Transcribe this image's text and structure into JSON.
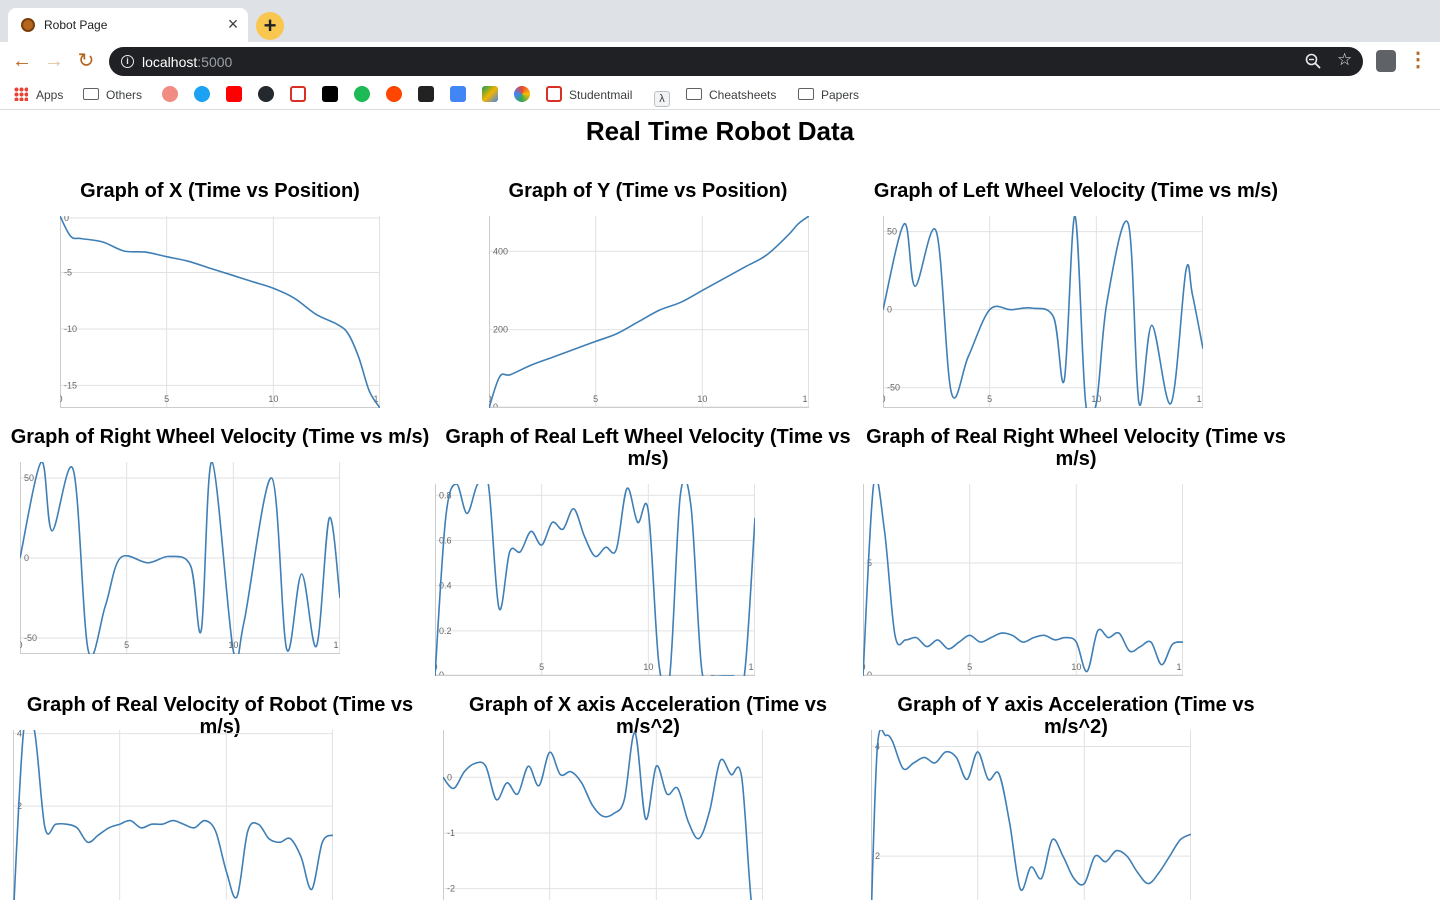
{
  "browser": {
    "tab_title": "Robot Page",
    "url_host": "localhost",
    "url_port": ":5000",
    "bookmarks": {
      "apps": "Apps",
      "others": "Others",
      "studentmail": "Studentmail",
      "cheatsheets": "Cheatsheets",
      "papers": "Papers"
    },
    "icons": [
      "favicon-icon",
      "close-icon",
      "plus-icon",
      "back-icon",
      "forward-icon",
      "reload-icon",
      "info-icon",
      "zoom-out-icon",
      "star-icon",
      "profile-icon",
      "menu-icon"
    ]
  },
  "page": {
    "title": "Real Time Robot Data"
  },
  "colors": {
    "line": "#3f7fb5",
    "grid": "#e2e2e2",
    "axis": "#cccccc"
  },
  "chart_data": [
    {
      "type": "line",
      "title": "Graph of X (Time vs Position)",
      "xticks": [
        "0",
        "5",
        "10",
        "1"
      ],
      "xlim": [
        0,
        15
      ],
      "yticks": [
        "0",
        "-5",
        "-10",
        "-15"
      ],
      "ytick_values": [
        0,
        -5,
        -10,
        -15
      ],
      "ylim": [
        -17,
        0
      ],
      "x": [
        0,
        0.5,
        1,
        2,
        3,
        4,
        5,
        6,
        7,
        8,
        9,
        10,
        11,
        12,
        13,
        13.5,
        14,
        14.5,
        15
      ],
      "y": [
        0,
        -1.8,
        -2,
        -2.3,
        -3.1,
        -3.2,
        -3.6,
        -4.0,
        -4.6,
        -5.2,
        -5.8,
        -6.4,
        -7.3,
        -8.7,
        -9.6,
        -10.4,
        -12.5,
        -15.5,
        -17
      ]
    },
    {
      "type": "line",
      "title": "Graph of Y (Time vs Position)",
      "xticks": [
        "0",
        "5",
        "10",
        "1"
      ],
      "xlim": [
        0,
        15
      ],
      "yticks": [
        "0",
        "200",
        "400"
      ],
      "ytick_values": [
        0,
        200,
        400
      ],
      "ylim": [
        0,
        490
      ],
      "x": [
        0,
        0.5,
        1,
        2,
        3,
        4,
        5,
        6,
        7,
        8,
        9,
        10,
        11,
        12,
        13,
        14,
        14.5,
        15
      ],
      "y": [
        0,
        80,
        85,
        110,
        130,
        150,
        170,
        190,
        220,
        250,
        270,
        300,
        330,
        360,
        390,
        440,
        470,
        490
      ]
    },
    {
      "type": "line",
      "title": "Graph of Left Wheel Velocity (Time vs m/s)",
      "xticks": [
        "0",
        "5",
        "10",
        "1"
      ],
      "xlim": [
        0,
        15
      ],
      "yticks": [
        "50",
        "0",
        "-50"
      ],
      "ytick_values": [
        50,
        0,
        -50
      ],
      "ylim": [
        -63,
        60
      ],
      "x": [
        0,
        1,
        1.5,
        2.5,
        3.2,
        4,
        5,
        6,
        7,
        8,
        8.5,
        9,
        9.5,
        10,
        10.5,
        11.5,
        12,
        12.6,
        13.5,
        14.2,
        14.5,
        15
      ],
      "y": [
        0,
        55,
        15,
        50,
        -53,
        -30,
        0,
        0,
        1,
        -5,
        -45,
        60,
        -60,
        -60,
        5,
        55,
        -60,
        -10,
        -60,
        25,
        10,
        -25
      ]
    },
    {
      "type": "line",
      "title": "Graph of Right Wheel Velocity (Time vs m/s)",
      "xticks": [
        "0",
        "5",
        "10",
        "1"
      ],
      "xlim": [
        0,
        15
      ],
      "yticks": [
        "50",
        "0",
        "-50"
      ],
      "ytick_values": [
        50,
        0,
        -50
      ],
      "ylim": [
        -60,
        60
      ],
      "x": [
        0,
        1,
        1.5,
        2.5,
        3.2,
        4,
        4.7,
        6,
        7,
        8,
        8.5,
        9,
        10,
        10.5,
        11.8,
        12.5,
        13.2,
        13.9,
        14.5,
        15
      ],
      "y": [
        0,
        60,
        17,
        55,
        -58,
        -30,
        0,
        -3,
        1,
        -5,
        -45,
        60,
        -58,
        -40,
        50,
        -57,
        -10,
        -55,
        25,
        -25
      ]
    },
    {
      "type": "line",
      "title": "Graph of Real Left Wheel Velocity (Time vs m/s)",
      "xticks": [
        "0",
        "5",
        "10",
        "1"
      ],
      "xlim": [
        0,
        15
      ],
      "yticks": [
        "0",
        "0.2",
        "0.4",
        "0.6",
        "0.8"
      ],
      "ytick_values": [
        0,
        0.2,
        0.4,
        0.6,
        0.8
      ],
      "ylim": [
        0,
        0.85
      ],
      "x": [
        0,
        0.5,
        1,
        1.5,
        2,
        2.5,
        3,
        3.5,
        4,
        4.5,
        5,
        5.5,
        6,
        6.5,
        7,
        7.5,
        8,
        8.5,
        9,
        9.5,
        10,
        10.5,
        11,
        11.5,
        12,
        12.5,
        13,
        13.5,
        14,
        14.5,
        15
      ],
      "y": [
        0,
        0.7,
        0.85,
        0.72,
        0.85,
        0.85,
        0.3,
        0.55,
        0.55,
        0.64,
        0.58,
        0.68,
        0.65,
        0.74,
        0.62,
        0.53,
        0.57,
        0.56,
        0.83,
        0.68,
        0.73,
        0.05,
        0,
        0.8,
        0.75,
        0.03,
        0,
        0,
        0,
        0,
        0.7
      ]
    },
    {
      "type": "line",
      "title": "Graph of Real Right Wheel Velocity (Time vs m/s)",
      "xticks": [
        "0",
        "5",
        "10",
        "1"
      ],
      "xlim": [
        0,
        15
      ],
      "yticks": [
        "5",
        "0"
      ],
      "ytick_values": [
        5,
        0
      ],
      "ylim": [
        0,
        8.5
      ],
      "x": [
        0,
        0.5,
        1,
        1.5,
        2,
        2.5,
        3,
        3.5,
        4,
        4.5,
        5,
        5.5,
        6,
        6.5,
        7,
        7.5,
        8,
        8.5,
        9,
        9.5,
        10,
        10.5,
        11,
        11.5,
        12,
        12.5,
        13,
        13.5,
        14,
        14.5,
        15
      ],
      "y": [
        0,
        8.5,
        6.5,
        1.8,
        1.6,
        1.7,
        1.3,
        1.6,
        1.2,
        1.5,
        1.8,
        1.5,
        1.7,
        1.9,
        1.8,
        1.5,
        1.7,
        1.8,
        1.6,
        1.7,
        1.5,
        0.2,
        2.0,
        1.7,
        1.9,
        1.1,
        1.3,
        1.5,
        0.5,
        1.4,
        1.5
      ]
    },
    {
      "type": "line",
      "title": "Graph of Real Velocity of Robot (Time vs m/s)",
      "xticks": [],
      "xlim": [
        0,
        15
      ],
      "yticks": [
        "4",
        "2"
      ],
      "ytick_values": [
        4,
        2
      ],
      "ylim": [
        -1.2,
        4.1
      ],
      "x": [
        0,
        0.5,
        1,
        1.5,
        2,
        2.5,
        3,
        3.5,
        4,
        4.5,
        5,
        5.5,
        6,
        6.5,
        7,
        7.5,
        8,
        8.5,
        9,
        9.5,
        10,
        10.5,
        11,
        11.5,
        12,
        12.5,
        13,
        13.5,
        14,
        14.5,
        15
      ],
      "y": [
        -1.2,
        4.1,
        4.1,
        1.4,
        1.5,
        1.5,
        1.4,
        1.0,
        1.2,
        1.4,
        1.5,
        1.6,
        1.4,
        1.5,
        1.5,
        1.6,
        1.5,
        1.4,
        1.6,
        1.3,
        0.2,
        -0.5,
        1.3,
        1.5,
        1.1,
        1.0,
        1.1,
        0.6,
        -0.3,
        1.0,
        1.2
      ]
    },
    {
      "type": "line",
      "title": "Graph of X axis Acceleration (Time vs m/s^2)",
      "xticks": [],
      "xlim": [
        0,
        15
      ],
      "yticks": [
        "0",
        "-1",
        "-2"
      ],
      "ytick_values": [
        0,
        -1,
        -2
      ],
      "ylim": [
        -2.6,
        0.85
      ],
      "x": [
        0,
        0.5,
        1,
        1.5,
        2,
        2.5,
        3,
        3.5,
        4,
        4.5,
        5,
        5.5,
        6,
        6.5,
        7,
        7.5,
        8,
        8.5,
        9,
        9.5,
        10,
        10.5,
        11,
        11.5,
        12,
        12.5,
        13,
        13.5,
        14,
        14.5,
        15
      ],
      "y": [
        0,
        -0.2,
        0.1,
        0.25,
        0.2,
        -0.4,
        -0.1,
        -0.3,
        0.2,
        -0.15,
        0.45,
        0.05,
        0.1,
        -0.1,
        -0.5,
        -0.7,
        -0.65,
        -0.4,
        0.8,
        -0.75,
        0.2,
        -0.3,
        -0.2,
        -0.8,
        -1.1,
        -0.6,
        0.3,
        0.05,
        0,
        -2.4,
        -2.6
      ]
    },
    {
      "type": "line",
      "title": "Graph of Y axis Acceleration (Time vs m/s^2)",
      "xticks": [],
      "xlim": [
        0,
        15
      ],
      "yticks": [
        "4",
        "2"
      ],
      "ytick_values": [
        4,
        2
      ],
      "ylim": [
        0.8,
        4.3
      ],
      "x": [
        0,
        0.3,
        0.7,
        1,
        1.5,
        2,
        2.5,
        3,
        3.5,
        4,
        4.5,
        5,
        5.5,
        6,
        6.5,
        7,
        7.5,
        8,
        8.5,
        9,
        9.5,
        10,
        10.5,
        11,
        11.5,
        12,
        12.5,
        13,
        13.5,
        14,
        14.5,
        15
      ],
      "y": [
        0.8,
        4.0,
        4.2,
        4.1,
        3.6,
        3.7,
        3.8,
        3.7,
        3.9,
        3.8,
        3.4,
        3.9,
        3.4,
        3.5,
        2.6,
        1.4,
        1.8,
        1.6,
        2.3,
        2.0,
        1.6,
        1.5,
        2.0,
        1.9,
        2.1,
        2.0,
        1.7,
        1.5,
        1.7,
        2.0,
        2.3,
        2.4
      ]
    }
  ]
}
